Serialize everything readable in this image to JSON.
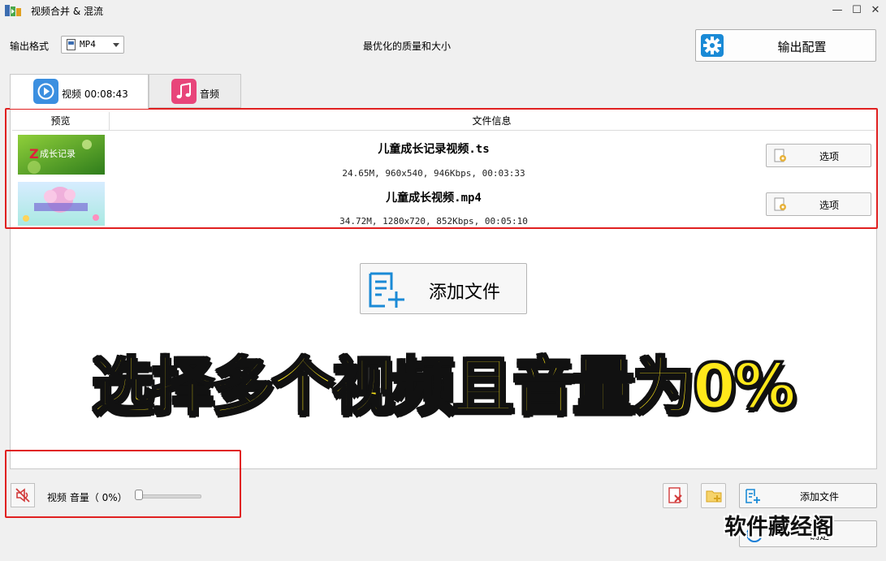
{
  "window": {
    "title": "视频合并 & 混流",
    "min_glyph": "—",
    "max_glyph": "☐",
    "close_glyph": "✕"
  },
  "toolbar": {
    "format_label": "输出格式",
    "format_value": "MP4",
    "quality_text": "最优化的质量和大小",
    "output_config_label": "输出配置"
  },
  "tabs": [
    {
      "label": "视频 00:08:43",
      "icon": "play-circle-icon",
      "color": "#3b8fe0",
      "active": true
    },
    {
      "label": "音频",
      "icon": "music-note-icon",
      "color": "#e8457a",
      "active": false
    }
  ],
  "list": {
    "headers": {
      "preview": "预览",
      "info": "文件信息"
    },
    "files": [
      {
        "name": "儿童成长记录视频.ts",
        "meta": "24.65M, 960x540, 946Kbps, 00:03:33",
        "thumb_text": "成长记录",
        "option_label": "选项"
      },
      {
        "name": "儿童成长视频.mp4",
        "meta": "34.72M, 1280x720, 852Kbps, 00:05:10",
        "thumb_text": "",
        "option_label": "选项"
      }
    ]
  },
  "add_file_big_label": "添加文件",
  "overlay_caption": "选择多个视频且音量为0%",
  "bottom": {
    "volume_label": "视频 音量（  0%）",
    "volume_fraction": 0,
    "add_file_label": "添加文件",
    "ok_label": "确定"
  },
  "watermark": "软件藏经阁",
  "colors": {
    "accent_blue": "#1a7ed6",
    "highlight_red": "#e02020",
    "caption_yellow": "#ffe81a"
  }
}
